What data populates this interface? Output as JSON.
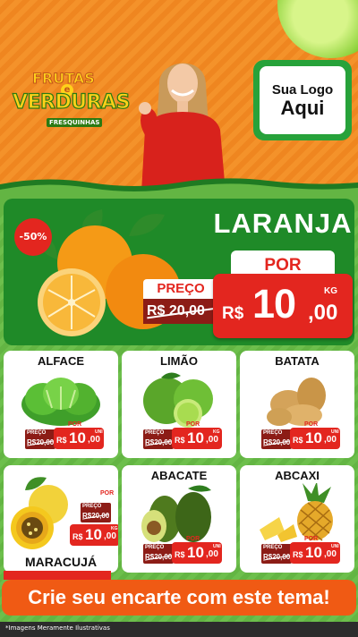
{
  "header": {
    "brand": {
      "line1": "FRUTAS",
      "connector": "e",
      "line2": "VERDURAS",
      "tagline": "FRESQUINHAS"
    },
    "logo_placeholder": {
      "line1": "Sua Logo",
      "line2": "Aqui"
    }
  },
  "featured": {
    "discount_badge": "-50%",
    "product": "LARANJA",
    "por_label": "POR",
    "old_price_label": "PREÇO",
    "old_price": "R$ 20,00",
    "currency": "R$",
    "price_int": "10",
    "price_dec": ",00",
    "unit": "KG"
  },
  "products": [
    {
      "name": "ALFACE",
      "old_label": "PREÇO",
      "old_price": "R$20,00",
      "por": "POR",
      "currency": "R$",
      "price_int": "10",
      "price_dec": ",00",
      "unit": "UNI"
    },
    {
      "name": "LIMÃO",
      "old_label": "PREÇO",
      "old_price": "R$20,00",
      "por": "POR",
      "currency": "R$",
      "price_int": "10",
      "price_dec": ",00",
      "unit": "KG"
    },
    {
      "name": "BATATA",
      "old_label": "PREÇO",
      "old_price": "R$20,00",
      "por": "POR",
      "currency": "R$",
      "price_int": "10",
      "price_dec": ",00",
      "unit": "UNI"
    },
    {
      "name": "MARACUJÁ",
      "old_label": "PREÇO",
      "old_price": "R$20,00",
      "por": "POR",
      "currency": "R$",
      "price_int": "10",
      "price_dec": ",00",
      "unit": "KG"
    },
    {
      "name": "ABACATE",
      "old_label": "PREÇO",
      "old_price": "R$20,00",
      "por": "POR",
      "currency": "R$",
      "price_int": "10",
      "price_dec": ",00",
      "unit": "UNI"
    },
    {
      "name": "ABCAXI",
      "old_label": "PREÇO",
      "old_price": "R$20,00",
      "por": "POR",
      "currency": "R$",
      "price_int": "10",
      "price_dec": ",00",
      "unit": "UNI"
    }
  ],
  "cta": "Crie seu encarte com este tema!",
  "footnote": "*Imagens Meramente Ilustrativas",
  "colors": {
    "orange": "#f0841c",
    "green": "#1f8a28",
    "light_green": "#6dbf4c",
    "red": "#e3261f",
    "dark_red": "#8c1c16"
  }
}
